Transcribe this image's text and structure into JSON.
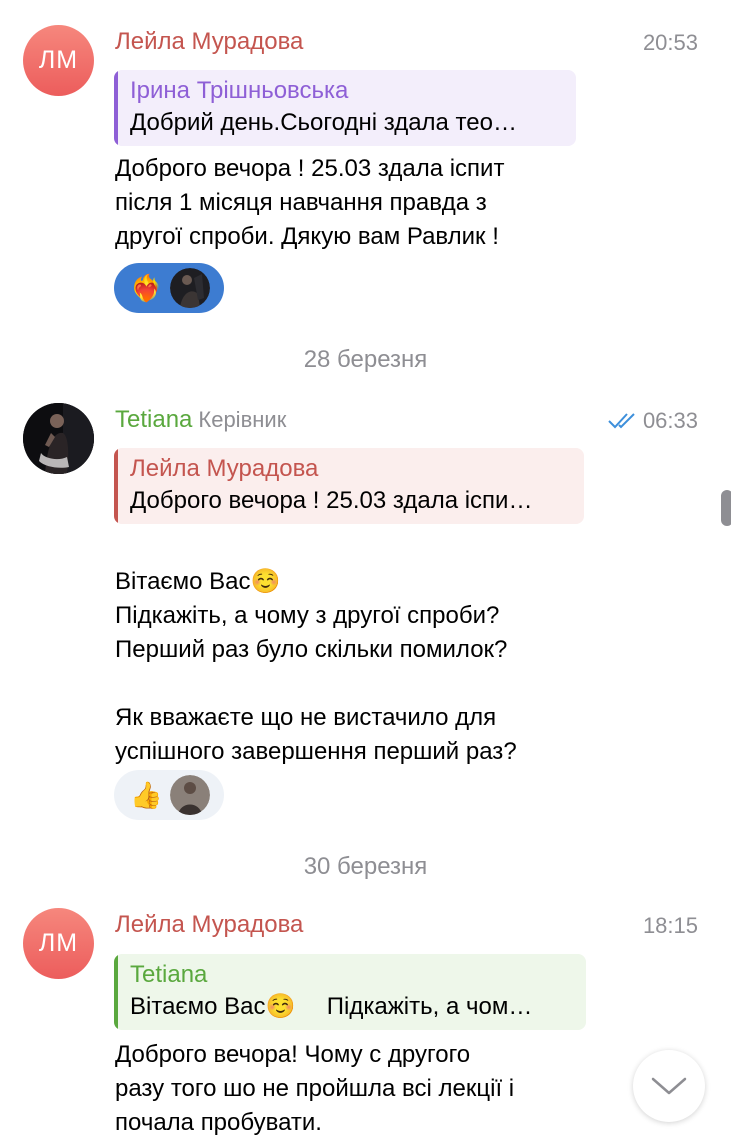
{
  "messages": [
    {
      "avatar_initials": "ЛМ",
      "sender": "Лейла Мурадова",
      "time": "20:53",
      "reply": {
        "name": "Ірина Трішньовська",
        "text": "Добрий день.Сьогодні здала тео…"
      },
      "text": "Доброго вечора ! 25.03 здала іспит\nпісля 1 місяця навчання  правда з\nдругої спроби. Дякую вам Равлик !",
      "reaction_icon": "heart-on-fire-icon"
    },
    {
      "sender": "Tetiana",
      "role": "Керівник",
      "time": "06:33",
      "status_icon": "double-check-icon",
      "reply": {
        "name": "Лейла Мурадова",
        "text": "Доброго вечора ! 25.03 здала іспи…"
      },
      "text_line1": "Вітаємо Вас",
      "text_rest": "Підкажіть, а чому з другої спроби?\nПерший раз було скільки помилок?\n\nЯк вважаєте що не вистачило для\nуспішного завершення перший раз?",
      "reaction_icon": "thumbs-up-icon"
    },
    {
      "avatar_initials": "ЛМ",
      "sender": "Лейла Мурадова",
      "time": "18:15",
      "reply": {
        "name": "Tetiana",
        "text_a": "Вітаємо Вас",
        "text_b": "Підкажіть, а чом…"
      },
      "text": "Доброго вечора!  Чому с другого\nразу того шо не пройшла всі лекції і\nпочала пробувати."
    }
  ],
  "date_separators": [
    "28 березня",
    "30 березня"
  ],
  "emoji": {
    "smile": "☺️",
    "heart_fire": "❤️‍🔥",
    "thumbs_up": "👍"
  },
  "colors": {
    "leila_name": "#c4554f",
    "irina_name": "#8e5fd6",
    "tetiana_name": "#5aa83e",
    "irina_reply_bg": "#f3eefb",
    "leila_reply_bg": "#fbeeed",
    "tetiana_reply_bg": "#eef7ea",
    "own_reaction_bg": "#3d7cd1",
    "reaction_bg": "#eef2f7",
    "check": "#3d8fdb"
  }
}
